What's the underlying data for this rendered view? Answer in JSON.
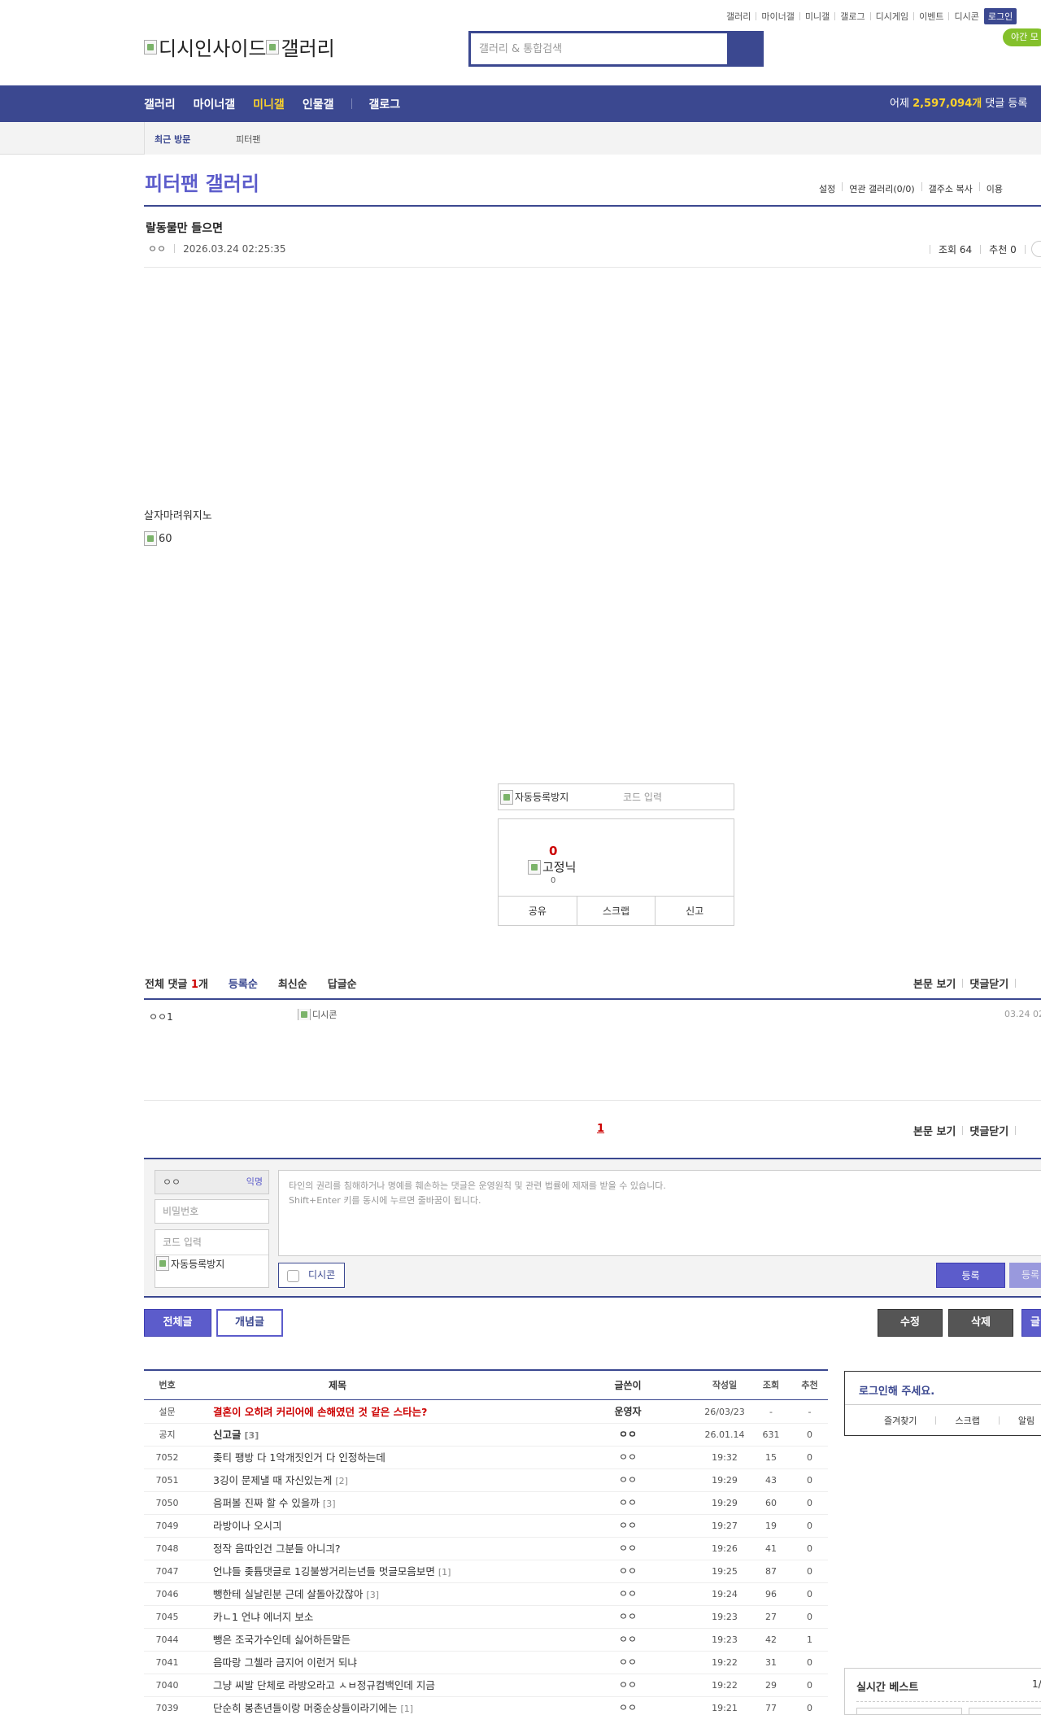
{
  "util_links": [
    "갤러리",
    "마이너갤",
    "미니갤",
    "갤로그",
    "디시게임",
    "이벤트",
    "디시콘"
  ],
  "login_label": "로그인",
  "night_mode": "야간 모",
  "logo": {
    "site": "디시인사이드",
    "gallery": "갤러리"
  },
  "search": {
    "placeholder": "갤러리 & 통합검색"
  },
  "gnb": {
    "items": [
      "갤러리",
      "마이너갤",
      "미니갤",
      "인물갤",
      "갤로그"
    ],
    "stat_prefix": "어제 ",
    "stat_count": "2,597,094개",
    "stat_suffix": " 댓글 등록"
  },
  "subnav": {
    "recent": "최근 방문",
    "gallery": "피터팬"
  },
  "gallery_title": "피터팬 갤러리",
  "gallery_menu": [
    "설정",
    "연관 갤러리(0/0)",
    "갤주소 복사",
    "이용"
  ],
  "post": {
    "title": "랄동물만 들으면",
    "author": "ㅇㅇ",
    "date": "2026.03.24 02:25:35",
    "views_label": "조회 64",
    "recommend_label": "추천 0",
    "body_text": "살자마려워지노",
    "image_alt": "60"
  },
  "captcha": {
    "alt": "자동등록방지",
    "placeholder": "코드 입력"
  },
  "vote": {
    "count": "0",
    "fixed_alt": "고정닉",
    "fixed_count": "0",
    "buttons": [
      "공유",
      "스크랩",
      "신고"
    ]
  },
  "comments": {
    "total_label": "전체 댓글 ",
    "total_count": "1",
    "total_unit": "개",
    "tabs": [
      "등록순",
      "최신순",
      "답글순"
    ],
    "right": [
      "본문 보기",
      "댓글닫기"
    ],
    "items": [
      {
        "nick": "ㅇㅇ1",
        "dccon_alt": "디시콘",
        "date": "03.24 02"
      }
    ],
    "page": "1"
  },
  "write": {
    "nick": "ㅇㅇ",
    "anon": "익명",
    "password_placeholder": "비밀번호",
    "code_placeholder": "코드 입력",
    "captcha_alt": "자동등록방지",
    "notice_line1": "타인의 권리를 침해하거나 명예를 훼손하는 댓글은 운영원칙 및 관련 법률에 제재를 받을 수 있습니다.",
    "notice_line2": "Shift+Enter 키를 동시에 누르면 줄바꿈이 됩니다.",
    "dccon": "디시콘",
    "submit": "등록",
    "submit2": "등록"
  },
  "buttons": {
    "all": "전체글",
    "best": "개념글",
    "edit": "수정",
    "delete": "삭제",
    "write": "글"
  },
  "list": {
    "headers": {
      "no": "번호",
      "title": "제목",
      "writer": "글쓴이",
      "date": "작성일",
      "views": "조회",
      "rec": "추천"
    },
    "rows": [
      {
        "no": "설문",
        "title": "결혼이 오히려 커리어에 손해였던 것 같은 스타는?",
        "reply": "",
        "writer": "운영자",
        "date": "26/03/23",
        "views": "-",
        "rec": "-",
        "type": "survey"
      },
      {
        "no": "공지",
        "title": "신고글",
        "reply": "[3]",
        "writer": "ㅇㅇ",
        "date": "26.01.14",
        "views": "631",
        "rec": "0",
        "type": "notice"
      },
      {
        "no": "7052",
        "title": "좆티 팽방 다 1악개짓인거 다 인정하는데",
        "reply": "",
        "writer": "ㅇㅇ",
        "date": "19:32",
        "views": "15",
        "rec": "0",
        "type": ""
      },
      {
        "no": "7051",
        "title": "3깅이 문제낼 때 자신있는게",
        "reply": "[2]",
        "writer": "ㅇㅇ",
        "date": "19:29",
        "views": "43",
        "rec": "0",
        "type": ""
      },
      {
        "no": "7050",
        "title": "음퍼볼 진짜 할 수 있을까",
        "reply": "[3]",
        "writer": "ㅇㅇ",
        "date": "19:29",
        "views": "60",
        "rec": "0",
        "type": ""
      },
      {
        "no": "7049",
        "title": "라방이나 오시긔",
        "reply": "",
        "writer": "ㅇㅇ",
        "date": "19:27",
        "views": "19",
        "rec": "0",
        "type": ""
      },
      {
        "no": "7048",
        "title": "정작 음따인건 그분들 아니긔?",
        "reply": "",
        "writer": "ㅇㅇ",
        "date": "19:26",
        "views": "41",
        "rec": "0",
        "type": ""
      },
      {
        "no": "7047",
        "title": "언냐들 좆튭댓글로 1깅불쌍거리는년들 멋글모음보면",
        "reply": "[1]",
        "writer": "ㅇㅇ",
        "date": "19:25",
        "views": "87",
        "rec": "0",
        "type": ""
      },
      {
        "no": "7046",
        "title": "뺑한테 실날린분 근데 살돌아갔잖아",
        "reply": "[3]",
        "writer": "ㅇㅇ",
        "date": "19:24",
        "views": "96",
        "rec": "0",
        "type": ""
      },
      {
        "no": "7045",
        "title": "카ㄴ1 언냐 에너지 보소",
        "reply": "",
        "writer": "ㅇㅇ",
        "date": "19:23",
        "views": "27",
        "rec": "0",
        "type": ""
      },
      {
        "no": "7044",
        "title": "뺑은 조국가수인데 싫어하든말든",
        "reply": "",
        "writer": "ㅇㅇ",
        "date": "19:23",
        "views": "42",
        "rec": "1",
        "type": ""
      },
      {
        "no": "7041",
        "title": "음따랑 그첼라 금지어 이런거 되냐",
        "reply": "",
        "writer": "ㅇㅇ",
        "date": "19:22",
        "views": "31",
        "rec": "0",
        "type": ""
      },
      {
        "no": "7040",
        "title": "그냥 씨발 단체로 라방오라고 ㅅㅂ정규컴백인데 지금",
        "reply": "",
        "writer": "ㅇㅇ",
        "date": "19:22",
        "views": "29",
        "rec": "0",
        "type": ""
      },
      {
        "no": "7039",
        "title": "단순히 봉촌년들이랑 머중순상들이라기에는",
        "reply": "[1]",
        "writer": "ㅇㅇ",
        "date": "19:21",
        "views": "77",
        "rec": "0",
        "type": ""
      }
    ]
  },
  "sidebar": {
    "login_prompt": "로그인해 주세요.",
    "links": [
      "즐겨찾기",
      "스크랩",
      "알림"
    ],
    "realtime_best": "실시간 베스트",
    "realtime_page": "1/"
  }
}
